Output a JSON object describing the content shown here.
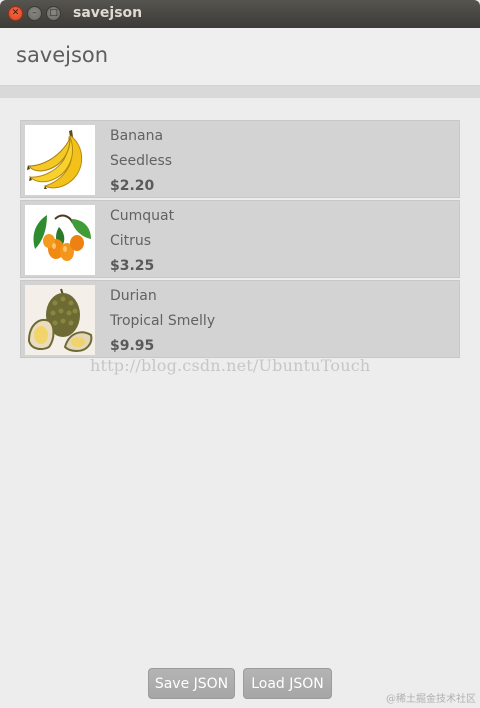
{
  "window": {
    "title": "savejson",
    "close_glyph": "✕",
    "minimize_glyph": "–",
    "maximize_glyph": "□"
  },
  "header": {
    "title": "savejson"
  },
  "fruits": [
    {
      "name": "Banana",
      "description": "Seedless",
      "price": "$2.20",
      "icon": "banana-image"
    },
    {
      "name": "Cumquat",
      "description": "Citrus",
      "price": "$3.25",
      "icon": "cumquat-image"
    },
    {
      "name": "Durian",
      "description": "Tropical Smelly",
      "price": "$9.95",
      "icon": "durian-image"
    }
  ],
  "watermark": "http://blog.csdn.net/UbuntuTouch",
  "corner_watermark": "@稀土掘金技术社区",
  "buttons": {
    "save_label": "Save JSON",
    "load_label": "Load JSON"
  },
  "colors": {
    "titlebar": "#3c3b37",
    "close_button": "#e0522d",
    "list_item_bg": "#d3d3d3",
    "button_bg": "#aaaaaa"
  }
}
